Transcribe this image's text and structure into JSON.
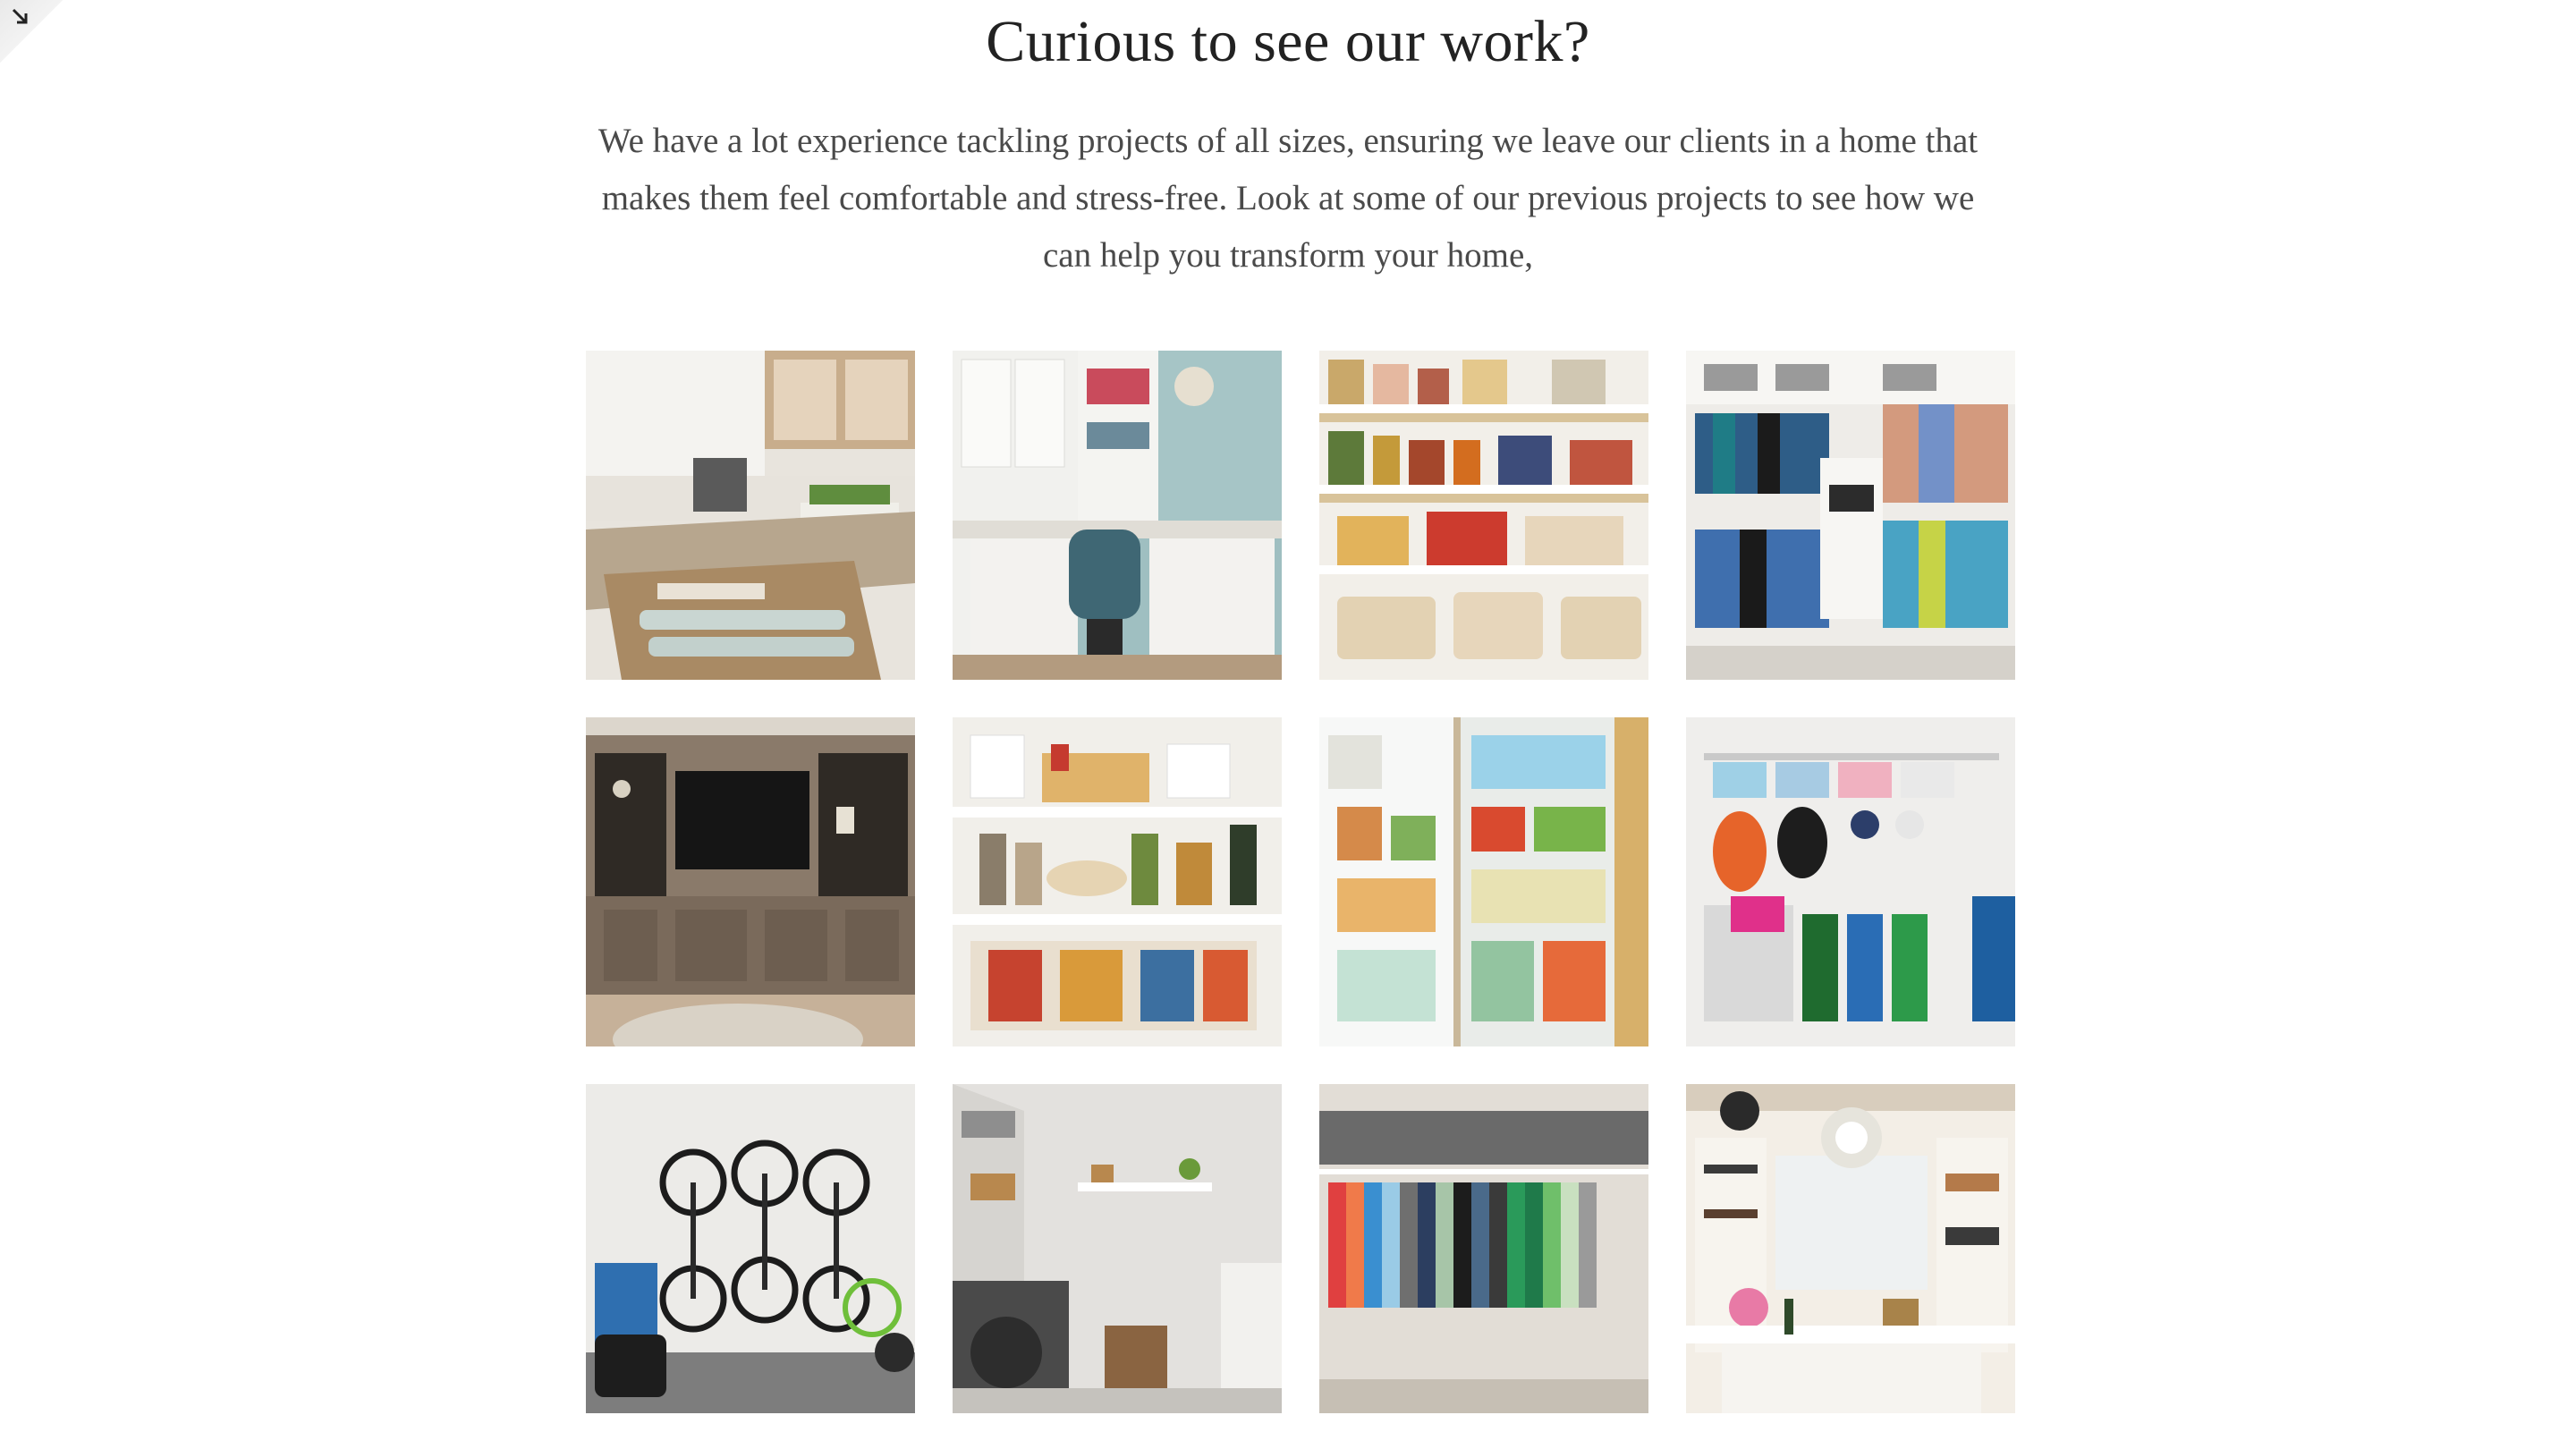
{
  "header": {
    "title": "Curious to see our work?",
    "intro": "We have a lot experience tackling projects of all sizes, ensuring we leave our clients in a home that makes them feel comfortable and stress-free. Look at some of our previous projects to see how we can help you transform your home,"
  },
  "corner": {
    "icon": "arrow-down-right-icon"
  },
  "gallery": {
    "tiles": [
      {
        "subject": "kitchen-drawers"
      },
      {
        "subject": "home-office"
      },
      {
        "subject": "pantry-shelves"
      },
      {
        "subject": "walk-in-closet"
      },
      {
        "subject": "built-in-entertainment-wall"
      },
      {
        "subject": "corner-pantry"
      },
      {
        "subject": "refrigerator-organization"
      },
      {
        "subject": "mudroom-storage"
      },
      {
        "subject": "garage-bike-rack"
      },
      {
        "subject": "laundry-room"
      },
      {
        "subject": "closet-hanging-rod"
      },
      {
        "subject": "dressing-room-chandelier"
      }
    ]
  },
  "colors": {
    "background": "#ffffff",
    "title": "#222222",
    "body_text": "#4a4a4a"
  }
}
